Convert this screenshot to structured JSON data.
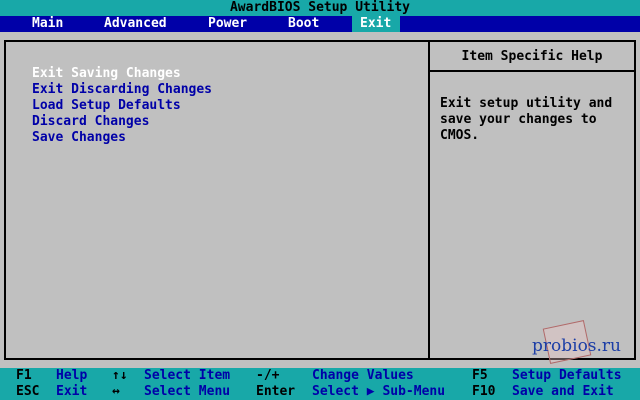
{
  "title": "AwardBIOS Setup Utility",
  "menu": [
    {
      "label": "Main"
    },
    {
      "label": "Advanced"
    },
    {
      "label": "Power"
    },
    {
      "label": "Boot"
    },
    {
      "label": "Exit"
    }
  ],
  "active_menu": "Exit",
  "options": [
    {
      "label": "Exit Saving Changes"
    },
    {
      "label": "Exit Discarding Changes"
    },
    {
      "label": "Load Setup Defaults"
    },
    {
      "label": "Discard Changes"
    },
    {
      "label": "Save Changes"
    }
  ],
  "selected_option": "Exit Saving Changes",
  "help": {
    "header": "Item Specific Help",
    "lines": [
      "Exit setup utility and",
      "save your changes to",
      "CMOS."
    ]
  },
  "watermark": "probios.ru",
  "footer": {
    "row1": {
      "k1": "F1",
      "d1": "Help",
      "k2_icon": "up-down-arrows-icon",
      "k2": "↑↓",
      "d2": "Select Item",
      "k3": "-/+",
      "d3": "Change Values",
      "k4": "F5",
      "d4": "Setup Defaults"
    },
    "row2": {
      "k1": "ESC",
      "d1": "Exit",
      "k2_icon": "left-right-arrows-icon",
      "k2": "↔",
      "d2": "Select Menu",
      "k3": "Enter",
      "d3": "Select ▶ Sub-Menu",
      "k4": "F10",
      "d4": "Save and Exit"
    }
  },
  "colors": {
    "background": "#c0c0c0",
    "title_bar": "#18a8a8",
    "menu_bar": "#0000a8",
    "option_text": "#0000a8",
    "selected_text": "#ffffff",
    "footer_bar": "#18a8a8"
  }
}
